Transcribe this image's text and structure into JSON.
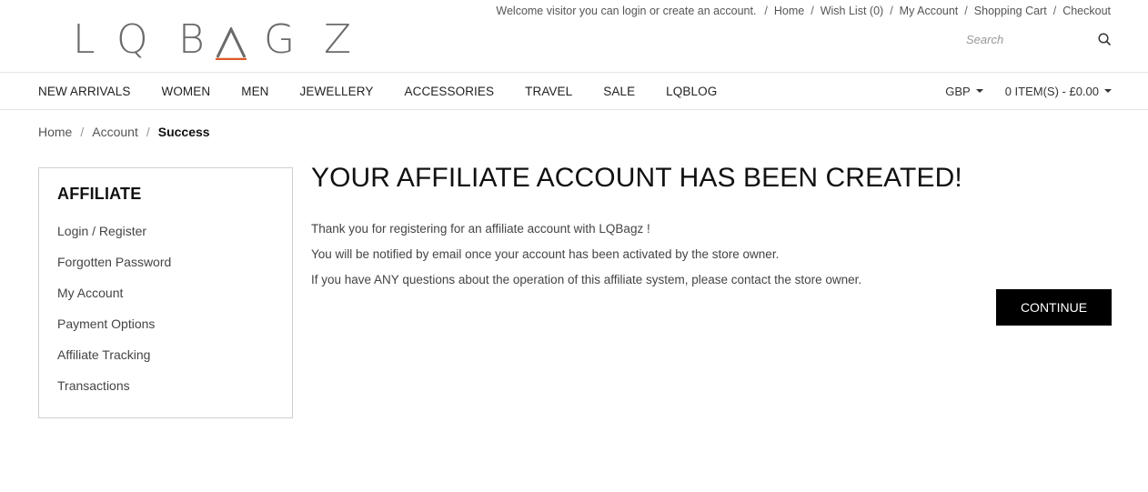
{
  "brand": {
    "logo_letters": [
      "L",
      "Q",
      "B",
      "A",
      "G",
      "Z"
    ],
    "accent_color": "#e05a2b"
  },
  "header": {
    "welcome": "Welcome visitor you can login or create an account.",
    "links": [
      "Home",
      "Wish List (0)",
      "My Account",
      "Shopping Cart",
      "Checkout"
    ],
    "search_placeholder": "Search",
    "search_icon": "search-icon"
  },
  "nav": {
    "items": [
      "NEW ARRIVALS",
      "WOMEN",
      "MEN",
      "JEWELLERY",
      "ACCESSORIES",
      "TRAVEL",
      "SALE",
      "LQBLOG"
    ],
    "currency": "GBP",
    "cart": "0 ITEM(S) - £0.00"
  },
  "breadcrumb": {
    "items": [
      "Home",
      "Account"
    ],
    "current": "Success"
  },
  "sidebar": {
    "title": "AFFILIATE",
    "items": [
      "Login / Register",
      "Forgotten Password",
      "My Account",
      "Payment Options",
      "Affiliate Tracking",
      "Transactions"
    ]
  },
  "main": {
    "title": "YOUR AFFILIATE ACCOUNT HAS BEEN CREATED!",
    "paragraphs": [
      "Thank you for registering for an affiliate account with LQBagz !",
      "You will be notified by email once your account has been activated by the store owner.",
      "If you have ANY questions about the operation of this affiliate system, please contact the store owner."
    ],
    "continue_label": "CONTINUE"
  }
}
